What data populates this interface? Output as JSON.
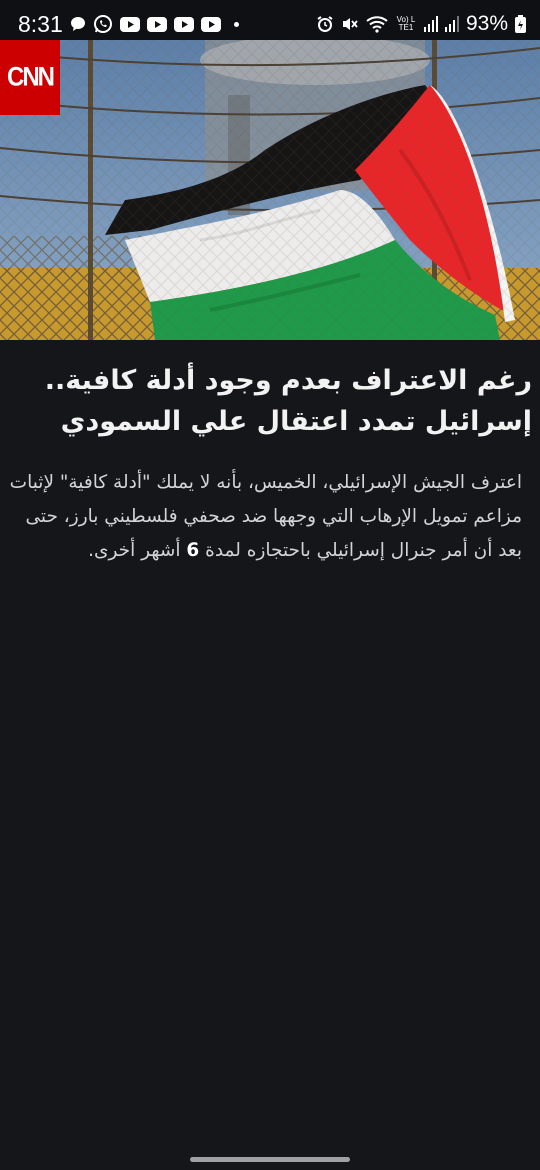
{
  "status_bar": {
    "time": "8:31",
    "left_icons": [
      "chat-bubble-icon",
      "whatsapp-icon",
      "youtube-icon",
      "youtube-icon",
      "youtube-icon",
      "youtube-icon",
      "dot-icon"
    ],
    "right_icons": [
      "alarm-icon",
      "mute-icon",
      "wifi-icon",
      "volte-icon",
      "signal-icon",
      "signal-icon",
      "battery-icon"
    ],
    "volte_label": "Vo) LTE1",
    "battery": "93%"
  },
  "brand": {
    "logo_text": "CNN",
    "logo_color": "#cc0000"
  },
  "article": {
    "headline_line1": "رغم الاعتراف بعدم وجود أدلة كافية..",
    "headline_line2": "إسرائيل تمدد اعتقال علي السمودي",
    "summary_part1": "اعترف الجيش الإسرائيلي، الخميس، بأنه لا يملك \"أدلة كافية\" لإثبات مزاعم تمويل الإرهاب التي وجهها ضد صحفي فلسطيني بارز، حتى بعد أن أمر جنرال إسرائيلي باحتجازه لمدة ",
    "summary_number": "6",
    "summary_part2": " أشهر أخرى."
  },
  "colors": {
    "background": "#151619",
    "flag_black": "#151515",
    "flag_white": "#eeeeee",
    "flag_green": "#1f9a49",
    "flag_red": "#e8262a"
  }
}
